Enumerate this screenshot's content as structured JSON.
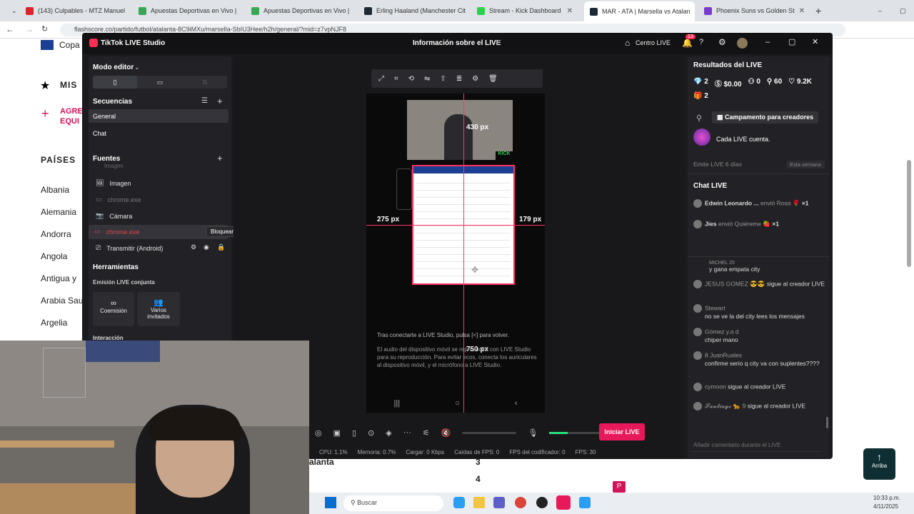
{
  "browser": {
    "tabs": [
      {
        "label": "(143) Culpables - MTZ Manuel",
        "color": "#d9232d"
      },
      {
        "label": "Apuestas Deportivas en Vivo |",
        "color": "#3aa655"
      },
      {
        "label": "Apuestas Deportivas en Vivo |",
        "color": "#3aa655"
      },
      {
        "label": "Erling Haaland (Manchester Cit",
        "color": "#1d2a36"
      },
      {
        "label": "Stream - Kick Dashboard",
        "color": "#2bd24b"
      },
      {
        "label": "MAR - ATA | Marsella vs Atalan",
        "color": "#1d2a36"
      },
      {
        "label": "Phoenix Suns vs Golden St",
        "color": "#7a3ccf"
      }
    ],
    "url": "flashscore.co/partido/futbol/atalanta-8C9iMXu/marsella-SbIU3Hee/h2h/general/?mid=z7vpNJF8"
  },
  "background_page": {
    "nav_items": [
      "Copa",
      "MIS",
      "AGRE",
      "EQUI"
    ],
    "countries_heading": "PAÍSES",
    "countries": [
      "Albania",
      "Alemania",
      "Andorra",
      "Angola",
      "Antigua y",
      "Arabia Sau",
      "Argelia"
    ],
    "bottom_team": "alanta",
    "bottom_values": [
      "3",
      "4"
    ],
    "back_to_top": "Arriba"
  },
  "tiktok": {
    "app_title": "TikTok LIVE Studio",
    "center_title": "Información sobre el LIVE",
    "centro_live": "Centro LIVE",
    "notif_count": "13",
    "mode": "Modo editor",
    "sequences_label": "Secuencias",
    "sequences": [
      "General",
      "Chat"
    ],
    "sources_label": "Fuentes",
    "sources": [
      "Imagen",
      "Imagen",
      "chrome.exe",
      "Cámara",
      "chrome.exe",
      "Transmitir (Android)"
    ],
    "tooltip": "Bloquear",
    "tools_label": "Herramientas",
    "collab_label": "Emisión LIVE conjunta",
    "cohost": "Coemisión",
    "multi_guest": "Varios invitados",
    "interaction": "Interacción",
    "measure": {
      "top": "430 px",
      "left": "275 px",
      "right": "179 px",
      "bottom": "750 px"
    },
    "phone_msg_1": "Tras conectarte a LIVE Studio, pulsa [<] para volver.",
    "phone_msg_2": "El audio del dispositivo móvil se reproducirá con LIVE Studio para su reproducción. Para evitar ecos, conecta los auriculares al dispositivo móvil, y el micrófono a LIVE Studio.",
    "start_live": "Iniciar LIVE",
    "status": {
      "cpu": "CPU: 1.1%",
      "mem": "Memoria: 0.7%",
      "load": "Cargar: 0 Kbps",
      "drops": "Caídas de FPS: 0",
      "enc": "FPS del codificador: 0",
      "fps": "FPS: 30"
    },
    "results": {
      "heading": "Resultados del LIVE",
      "diamonds": "2",
      "money": "$0.00",
      "viewers": "0",
      "followers": "60",
      "likes": "9.2K",
      "gifts": "2",
      "campaign": "Campamento para creadores",
      "promo": "Cada LIVE cuenta.",
      "emitted": "Emite LIVE 6 días",
      "week": "Esta semana"
    },
    "chat": {
      "heading": "Chat LIVE",
      "gifts": [
        {
          "user": "Edwin Leonardo ...",
          "text": "envió Rosa",
          "count": "×1"
        },
        {
          "user": "Jies",
          "text": "envió Quiéreme",
          "count": "×1"
        }
      ],
      "messages": [
        {
          "user": "MICHEL 25",
          "text": "y gana empata city"
        },
        {
          "user": "JESUS GOMEZ 😎😎",
          "text": "sigue al creador LIVE"
        },
        {
          "user": "Stewart",
          "text": "no se ve la del city lees los mensajes"
        },
        {
          "user": "Gómez y.a d",
          "text": "chiper mano"
        },
        {
          "user": "8 JuanRuales",
          "text": "confirme serio q city va con suplentes????"
        },
        {
          "user": "cymoon",
          "text": "sigue al creador LIVE"
        },
        {
          "user": "𝓢𝓪𝓷𝓽𝓲𝓪𝓰𝓸 🐆 9",
          "text": "sigue al creador LIVE"
        }
      ],
      "input_placeholder": "Añadir comentario durante el LIVE"
    }
  },
  "taskbar": {
    "search": "Buscar",
    "time": "10:33 p.m.",
    "date": "4/11/2025"
  }
}
